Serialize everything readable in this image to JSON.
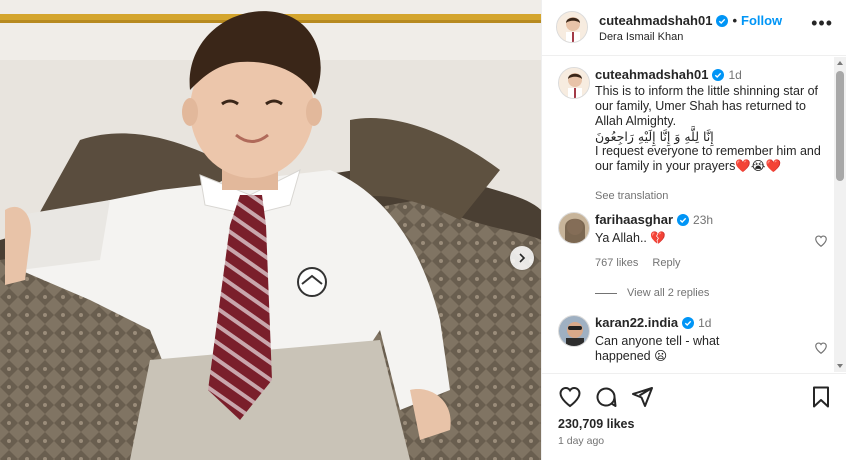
{
  "post": {
    "username": "cuteahmadshah01",
    "separator": "•",
    "follow_label": "Follow",
    "location": "Dera Ismail Khan",
    "more_icon": "more-horizontal-icon",
    "likes": "230,709 likes",
    "time_ago": "1 day ago"
  },
  "caption": {
    "username": "cuteahmadshah01",
    "time": "1d",
    "line1": "This is to inform the little shinning star of our family, Umer Shah has returned to Allah Almighty.",
    "arabic": "إِنَّا لِلَّهِ وَ إِنَّا إِلَيْهِ رَاجِعُونَ",
    "line2": "I request everyone to remember him and our family in your prayers",
    "emojis": "❤️😭❤️",
    "see_translation": "See translation"
  },
  "comments": [
    {
      "username": "farihaasghar",
      "time": "23h",
      "text": "Ya Allah..",
      "emoji": "💔",
      "likes": "767 likes",
      "reply": "Reply",
      "view_replies": "View all 2 replies"
    },
    {
      "username": "karan22.india",
      "time": "1d",
      "text": "Can anyone tell - what happened",
      "emoji": "😦"
    }
  ],
  "colors": {
    "accent": "#0095f6",
    "verified": "#0095f6",
    "heart": "#e0245e",
    "muted": "#737373"
  }
}
